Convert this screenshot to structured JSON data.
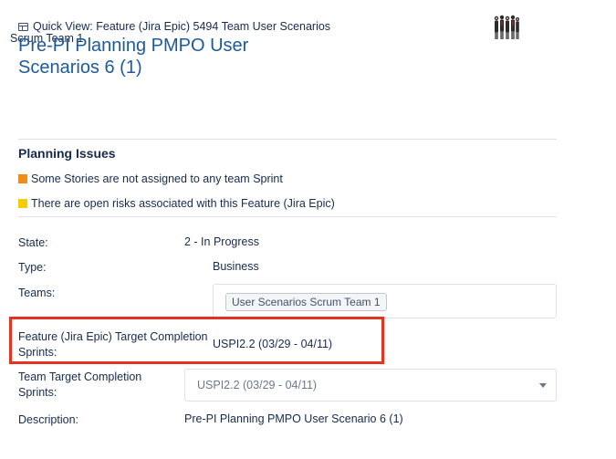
{
  "quick_view": {
    "title": "Quick View: Feature (Jira Epic) 5494 Team User Scenarios",
    "icon": "panel-icon"
  },
  "team_overlay": "Scrum Team 1",
  "page_title": "Pre-PI Planning PMPO User Scenarios 6 (1)",
  "planning": {
    "title": "Planning Issues",
    "issues": [
      {
        "text": "Some Stories are not assigned to any team Sprint",
        "color": "#f18c16"
      },
      {
        "text": "There are open risks associated with this Feature (Jira Epic)",
        "color": "#f5cd00"
      }
    ]
  },
  "fields": {
    "state": {
      "label": "State:",
      "value": "2 - In Progress"
    },
    "type": {
      "label": "Type:",
      "value": "Business"
    },
    "teams": {
      "label": "Teams:",
      "chip": "User Scenarios Scrum Team 1"
    },
    "epic_target": {
      "label": "Feature (Jira Epic) Target Completion Sprints:",
      "value": "USPI2.2 (03/29 - 04/11)"
    },
    "team_target": {
      "label": "Team Target Completion Sprints:",
      "value": "USPI2.2 (03/29 - 04/11)"
    },
    "description": {
      "label": "Description:",
      "value": "Pre-PI Planning PMPO User Scenario 6 (1)"
    }
  },
  "colors": {
    "title_blue": "#1d5a9c",
    "highlight_red": "#e3341f"
  }
}
